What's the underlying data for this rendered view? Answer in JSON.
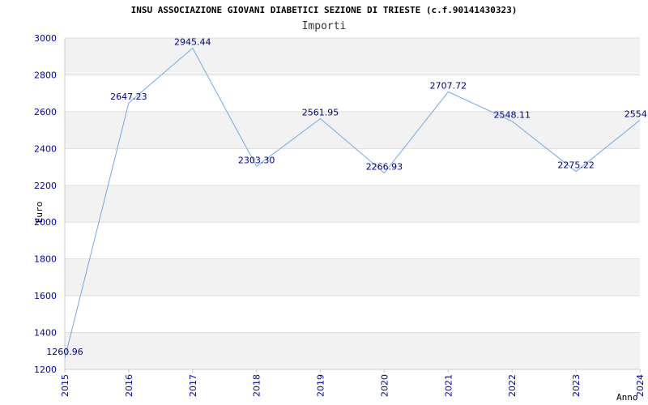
{
  "chart_data": {
    "type": "line",
    "title": "INSU ASSOCIAZIONE GIOVANI DIABETICI SEZIONE DI TRIESTE (c.f.90141430323)",
    "subtitle": "Importi",
    "ylabel": "Euro",
    "xlabel": "Anno",
    "ylim": [
      1200,
      3000
    ],
    "yticks": [
      1200,
      1400,
      1600,
      1800,
      2000,
      2200,
      2400,
      2600,
      2800,
      3000
    ],
    "x": [
      "2015",
      "2016",
      "2017",
      "2018",
      "2019",
      "2020",
      "2021",
      "2022",
      "2023",
      "2024"
    ],
    "values": [
      1260.96,
      2647.23,
      2945.44,
      2303.3,
      2561.95,
      2266.93,
      2707.72,
      2548.11,
      2275.22,
      2554.0
    ],
    "labels": [
      "1260.96",
      "2647.23",
      "2945.44",
      "2303.30",
      "2561.95",
      "2266.93",
      "2707.72",
      "2548.11",
      "2275.22",
      "2554.0"
    ],
    "line_color": "#6fa8e6",
    "grid": true,
    "band_color": "#f2f2f2",
    "tick_color": "#0000aa",
    "label_color": "#000080"
  }
}
